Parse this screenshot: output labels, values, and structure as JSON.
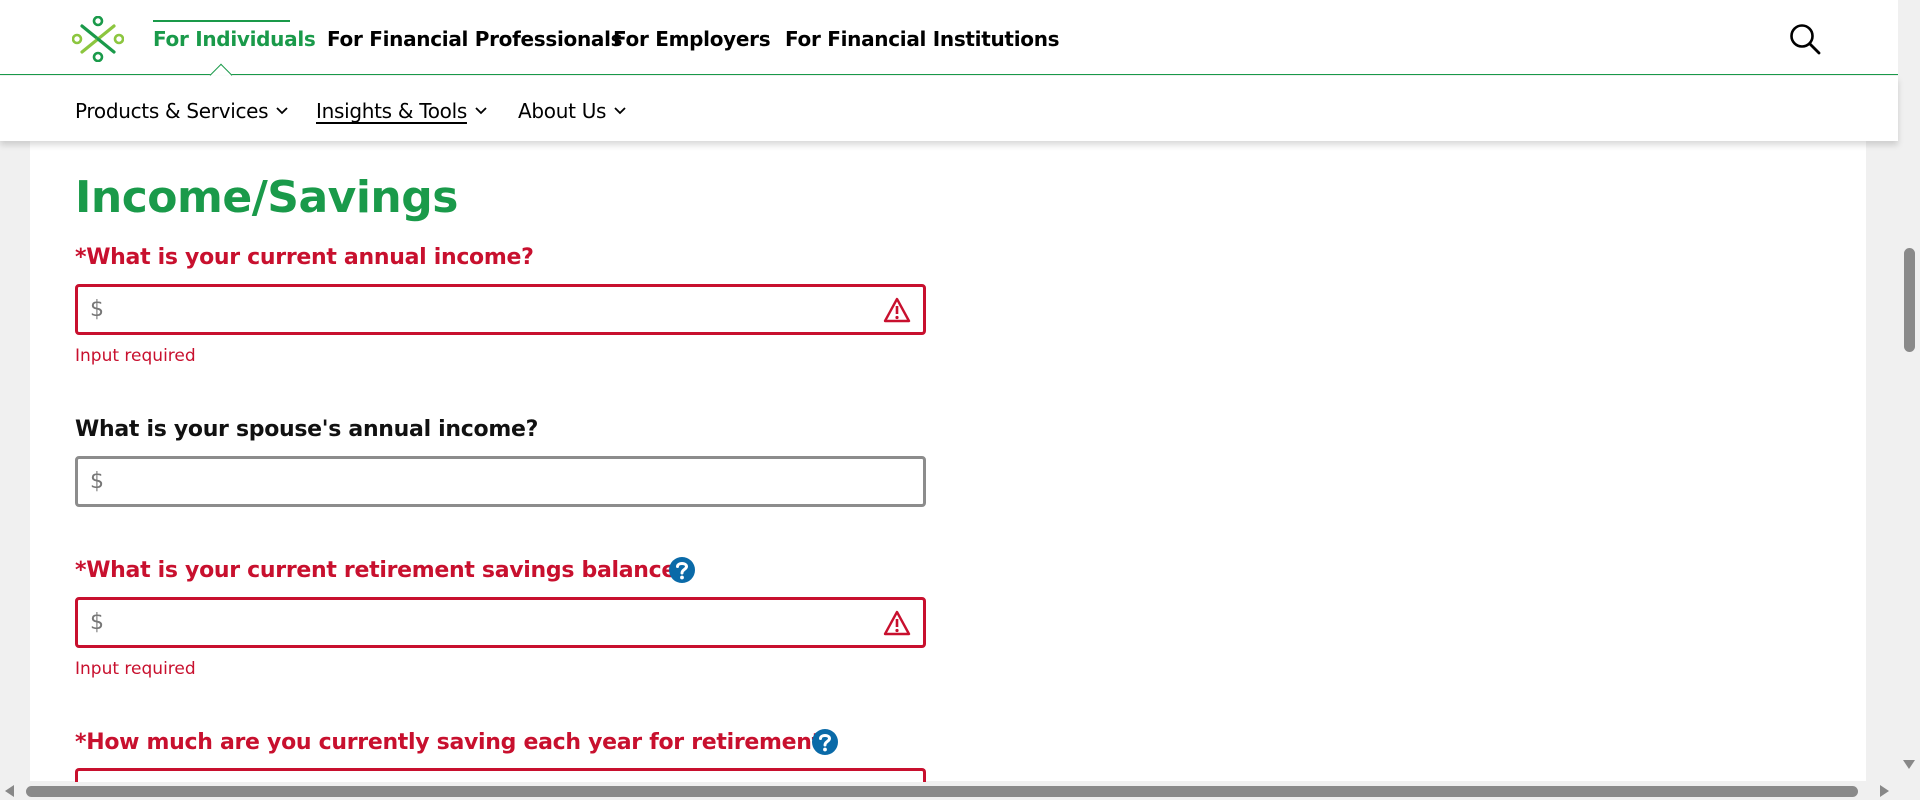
{
  "header": {
    "logo_icon": "brand-logo-icon",
    "audience_links": [
      {
        "label": "For Individuals",
        "active": true
      },
      {
        "label": "For Financial Professionals",
        "active": false
      },
      {
        "label": "For Employers",
        "active": false
      },
      {
        "label": "For Financial Institutions",
        "active": false
      }
    ],
    "search_icon": "search-icon"
  },
  "subnav": {
    "items": [
      {
        "label": "Products & Services"
      },
      {
        "label": "Insights & Tools",
        "current": true
      },
      {
        "label": "About Us"
      }
    ]
  },
  "form": {
    "section_title": "Income/Savings",
    "questions": [
      {
        "label": "*What is your current annual income?",
        "prefix": "$",
        "value": "",
        "error": "Input required",
        "state": "error"
      },
      {
        "label": "What is your spouse's annual income?",
        "prefix": "$",
        "value": "",
        "state": "normal"
      },
      {
        "label": "*What is your current retirement savings balance?",
        "prefix": "$",
        "value": "",
        "error": "Input required",
        "state": "error",
        "help": true
      },
      {
        "label": "*How much are you currently saving each year for retirement?",
        "state": "error",
        "help": true
      }
    ]
  },
  "colors": {
    "brand_green": "#1a9a4a",
    "error_red": "#c8102e",
    "help_blue": "#0a6aa8"
  }
}
